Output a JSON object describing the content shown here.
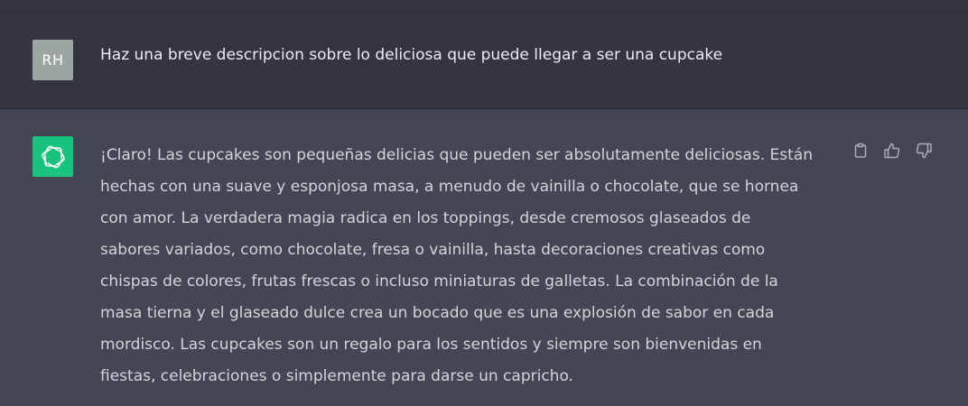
{
  "conversation": {
    "user_message": {
      "avatar_initials": "RH",
      "text": "Haz una breve descripcion sobre lo deliciosa que puede llegar a ser una cupcake"
    },
    "assistant_message": {
      "avatar_icon": "openai-logo-icon",
      "lines": [
        "¡Claro! Las cupcakes son pequeñas delicias que pueden ser absolutamente deliciosas. Están",
        "hechas con una suave y esponjosa masa, a menudo de vainilla o chocolate, que se hornea",
        "con amor. La verdadera magia radica en los toppings, desde cremosos glaseados de",
        "sabores variados, como chocolate, fresa o vainilla, hasta decoraciones creativas como",
        "chispas de colores, frutas frescas o incluso miniaturas de galletas. La combinación de la",
        "masa tierna y el glaseado dulce crea un bocado que es una explosión de sabor en cada",
        "mordisco. Las cupcakes son un regalo para los sentidos y siempre son bienvenidas en",
        "fiestas, celebraciones o simplemente para darse un capricho."
      ],
      "actions": [
        "copy-icon",
        "thumbs-up-icon",
        "thumbs-down-icon"
      ]
    }
  },
  "colors": {
    "user_row_bg": "#343541",
    "assistant_row_bg": "#444654",
    "user_avatar_bg": "#9ca5a4",
    "bot_avatar_bg": "#19c37d",
    "text": "#d1d5db"
  }
}
